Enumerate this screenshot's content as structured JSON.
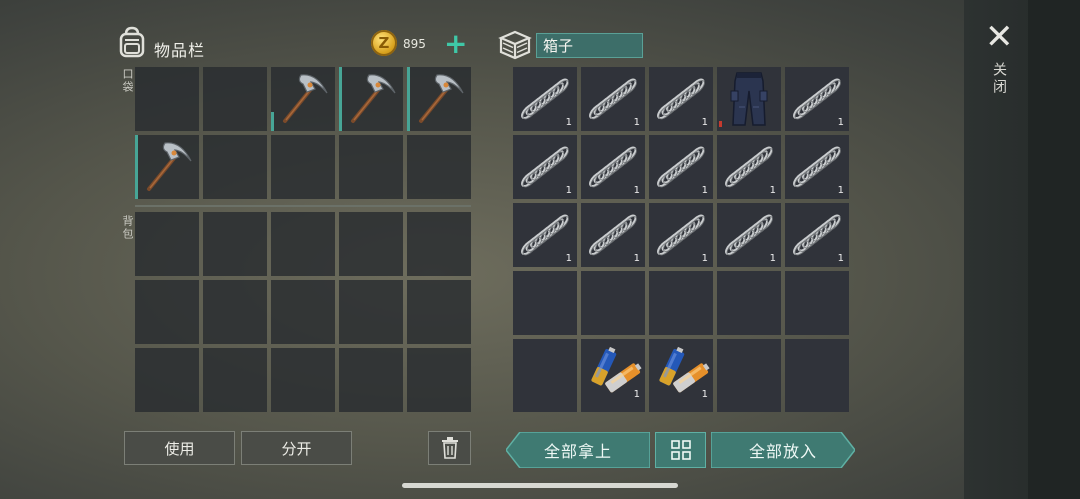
{
  "inventory": {
    "title": "物品栏",
    "coins": "895",
    "coin_symbol": "Z",
    "pocket_label": "口袋",
    "backpack_label": "背包",
    "use_label": "使用",
    "split_label": "分开"
  },
  "box": {
    "name": "箱子",
    "take_all_label": "全部拿上",
    "put_all_label": "全部放入"
  },
  "close_label": "关闭",
  "pocket_slots": [
    {
      "item": "",
      "count": ""
    },
    {
      "item": "",
      "count": ""
    },
    {
      "item": "pickaxe",
      "count": "",
      "durability": 0.3
    },
    {
      "item": "pickaxe",
      "count": "",
      "durability": 1.0
    },
    {
      "item": "pickaxe",
      "count": "",
      "durability": 1.0
    },
    {
      "item": "pickaxe",
      "count": "",
      "durability": 1.0
    },
    {
      "item": "",
      "count": ""
    },
    {
      "item": "",
      "count": ""
    },
    {
      "item": "",
      "count": ""
    },
    {
      "item": "",
      "count": ""
    }
  ],
  "backpack_slots": [
    {
      "item": ""
    },
    {
      "item": ""
    },
    {
      "item": ""
    },
    {
      "item": ""
    },
    {
      "item": ""
    },
    {
      "item": ""
    },
    {
      "item": ""
    },
    {
      "item": ""
    },
    {
      "item": ""
    },
    {
      "item": ""
    },
    {
      "item": ""
    },
    {
      "item": ""
    },
    {
      "item": ""
    },
    {
      "item": ""
    },
    {
      "item": ""
    }
  ],
  "box_slots": [
    {
      "item": "spring",
      "count": "1"
    },
    {
      "item": "spring",
      "count": "1"
    },
    {
      "item": "spring",
      "count": "1"
    },
    {
      "item": "pants",
      "count": "",
      "damaged": true
    },
    {
      "item": "spring",
      "count": "1"
    },
    {
      "item": "spring",
      "count": "1"
    },
    {
      "item": "spring",
      "count": "1"
    },
    {
      "item": "spring",
      "count": "1"
    },
    {
      "item": "spring",
      "count": "1"
    },
    {
      "item": "spring",
      "count": "1"
    },
    {
      "item": "spring",
      "count": "1"
    },
    {
      "item": "spring",
      "count": "1"
    },
    {
      "item": "spring",
      "count": "1"
    },
    {
      "item": "spring",
      "count": "1"
    },
    {
      "item": "spring",
      "count": "1"
    },
    {
      "item": "",
      "count": ""
    },
    {
      "item": "",
      "count": ""
    },
    {
      "item": "",
      "count": ""
    },
    {
      "item": "",
      "count": ""
    },
    {
      "item": "",
      "count": ""
    },
    {
      "item": "",
      "count": ""
    },
    {
      "item": "batteries",
      "count": "1"
    },
    {
      "item": "batteries",
      "count": "1"
    },
    {
      "item": "",
      "count": ""
    },
    {
      "item": "",
      "count": ""
    }
  ],
  "icons": {
    "backpack": "backpack-icon",
    "coin": "coin-icon",
    "add": "plus-icon",
    "box": "crate-icon",
    "trash": "trash-icon",
    "sort": "grid-icon",
    "close": "close-icon"
  },
  "colors": {
    "accent_teal": "#3d6e69",
    "plus_green": "#3fc7a7",
    "durability": "#47a596",
    "damage_red": "#c63a2e"
  }
}
